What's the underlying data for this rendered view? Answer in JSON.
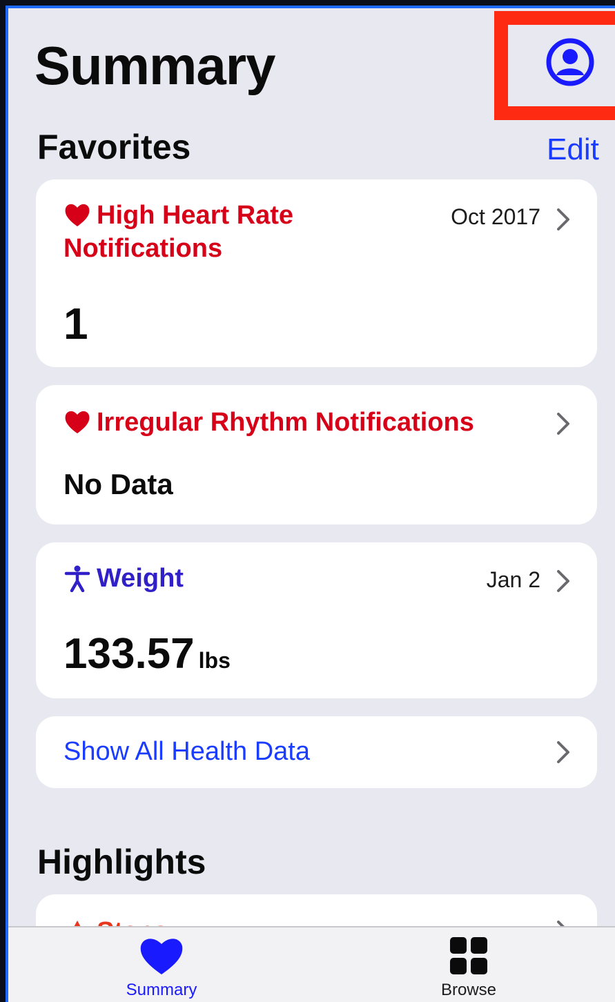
{
  "header": {
    "title": "Summary",
    "profile_icon": "person-circle-icon"
  },
  "favorites": {
    "heading": "Favorites",
    "edit_label": "Edit",
    "cards": [
      {
        "icon": "heart-icon",
        "title": "High Heart Rate Notifications",
        "title_line1": "High Heart Rate",
        "title_line2": "Notifications",
        "date": "Oct 2017",
        "value": "1",
        "color": "#d60018"
      },
      {
        "icon": "heart-icon",
        "title": "Irregular Rhythm Notifications",
        "date": "",
        "value": "No Data",
        "color": "#d60018"
      },
      {
        "icon": "body-figure-icon",
        "title": "Weight",
        "date": "Jan 2",
        "value": "133.57",
        "unit": "lbs",
        "color": "#3120c8"
      }
    ],
    "show_all_label": "Show All Health Data"
  },
  "highlights": {
    "heading": "Highlights",
    "partial_card_title": "Steps"
  },
  "tabbar": {
    "tabs": [
      {
        "label": "Summary",
        "icon": "heart-icon",
        "active": true,
        "color": "#1a1aff"
      },
      {
        "label": "Browse",
        "icon": "grid-icon",
        "active": false,
        "color": "#0b0b0b"
      }
    ]
  },
  "colors": {
    "accent": "#1a3cff",
    "heart_red": "#d60018",
    "highlight_box": "#ff2a12",
    "background": "#e8e8f0"
  }
}
